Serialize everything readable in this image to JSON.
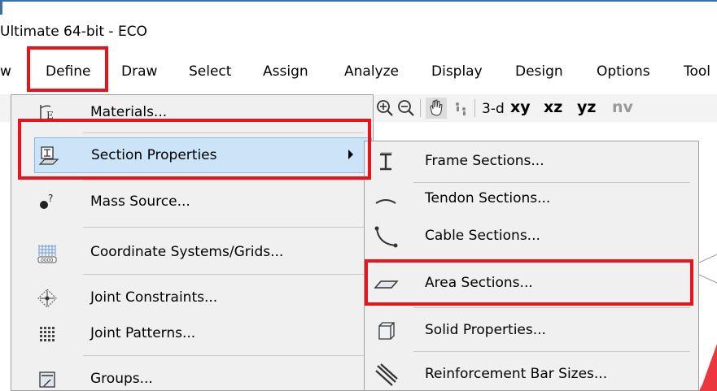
{
  "window": {
    "title": "Ultimate 64-bit - ECO"
  },
  "menu_bar": {
    "items": [
      {
        "label": "w"
      },
      {
        "label": "Define"
      },
      {
        "label": "Draw"
      },
      {
        "label": "Select"
      },
      {
        "label": "Assign"
      },
      {
        "label": "Analyze"
      },
      {
        "label": "Display"
      },
      {
        "label": "Design"
      },
      {
        "label": "Options"
      },
      {
        "label": "Tool"
      }
    ]
  },
  "toolbar": {
    "view_3d": "3-d",
    "xy": "xy",
    "xz": "xz",
    "yz": "yz",
    "nv": "nv",
    "icons": [
      "zoom-in-icon",
      "zoom-out-icon",
      "pan-hand-icon",
      "walk-icon"
    ]
  },
  "define_menu": {
    "items": [
      {
        "label": "Materials...",
        "icon": "materials-icon"
      },
      {
        "label": "Section Properties",
        "icon": "section-properties-icon",
        "has_submenu": true,
        "highlighted": true
      },
      {
        "label": "Mass Source...",
        "icon": "mass-source-icon"
      },
      {
        "label": "Coordinate Systems/Grids...",
        "icon": "grid-icon"
      },
      {
        "label": "Joint Constraints...",
        "icon": "joint-constraints-icon"
      },
      {
        "label": "Joint Patterns...",
        "icon": "joint-patterns-icon"
      },
      {
        "label": "Groups...",
        "icon": "groups-icon"
      }
    ]
  },
  "section_submenu": {
    "items": [
      {
        "label": "Frame Sections...",
        "icon": "frame-section-icon"
      },
      {
        "label": "Tendon Sections...",
        "icon": "tendon-icon"
      },
      {
        "label": "Cable Sections...",
        "icon": "cable-icon"
      },
      {
        "label": "Area Sections...",
        "icon": "area-section-icon"
      },
      {
        "label": "Solid Properties...",
        "icon": "solid-icon"
      },
      {
        "label": "Reinforcement Bar Sizes...",
        "icon": "rebar-icon"
      }
    ]
  },
  "highlight_color": "#e8141b"
}
